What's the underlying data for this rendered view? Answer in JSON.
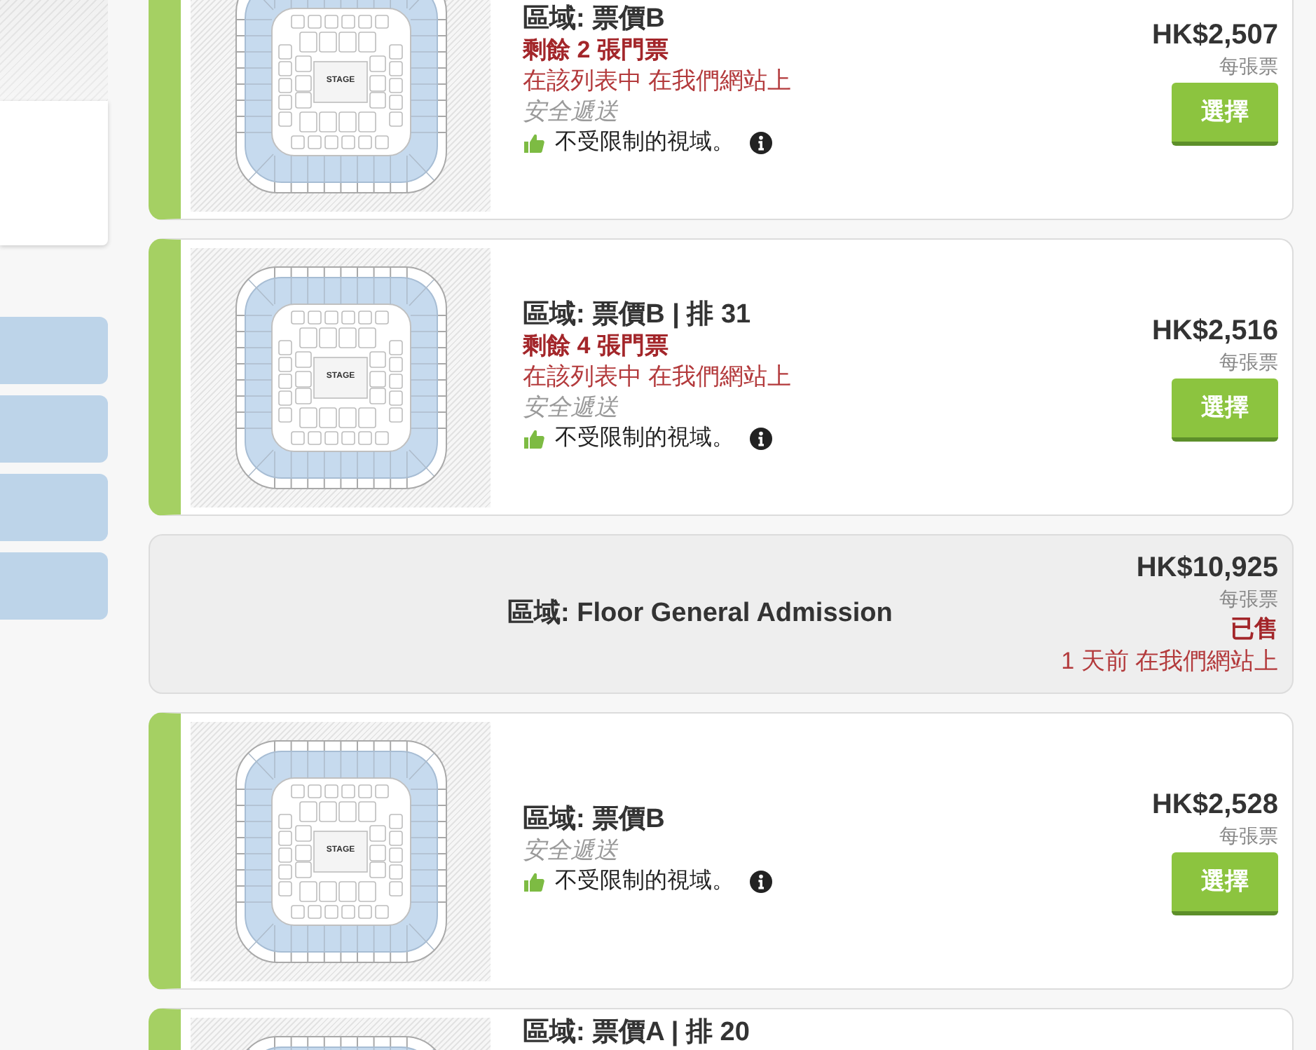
{
  "listings": [
    {
      "kind": "available",
      "stage_label": "STAGE",
      "title": "區域: 票價B",
      "remaining": "剩餘 2 張門票",
      "listing_note": "在該列表中 在我們網站上",
      "delivery": "安全遞送",
      "feature": "不受限制的視域。",
      "price": "HK$2,507",
      "price_note": "每張票",
      "button": "選擇"
    },
    {
      "kind": "available",
      "stage_label": "STAGE",
      "title": "區域: 票價B | 排 31",
      "remaining": "剩餘 4 張門票",
      "listing_note": "在該列表中 在我們網站上",
      "delivery": "安全遞送",
      "feature": "不受限制的視域。",
      "price": "HK$2,516",
      "price_note": "每張票",
      "button": "選擇"
    },
    {
      "kind": "sold",
      "title": "區域: Floor General Admission",
      "price": "HK$10,925",
      "price_note": "每張票",
      "status": "已售",
      "sold_note": "1 天前 在我們網站上"
    },
    {
      "kind": "available",
      "stage_label": "STAGE",
      "title": "區域: 票價B",
      "delivery": "安全遞送",
      "feature": "不受限制的視域。",
      "price": "HK$2,528",
      "price_note": "每張票",
      "button": "選擇"
    },
    {
      "kind": "available",
      "title": "區域: 票價A | 排 20"
    }
  ]
}
